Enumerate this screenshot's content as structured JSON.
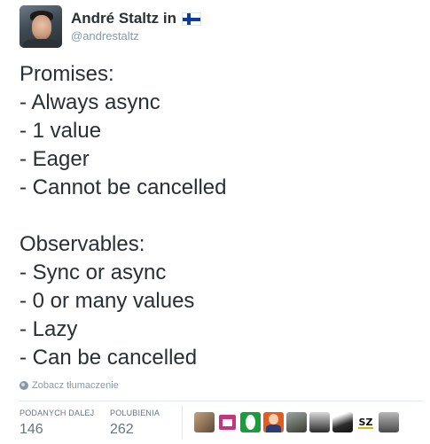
{
  "author": {
    "display_name": "André Staltz in",
    "handle": "@andrestaltz",
    "flag_icon": "finland-flag-icon",
    "avatar_icon": "avatar-photo"
  },
  "tweet": {
    "lines": [
      "Promises:",
      "- Always async",
      "- 1 value",
      "- Eager",
      "- Cannot be cancelled",
      "",
      "Observables:",
      "- Sync or async",
      "- 0 or many values",
      "- Lazy",
      "- Can be cancelled"
    ]
  },
  "translate": {
    "icon": "globe-icon",
    "label": "Zobacz tłumaczenie"
  },
  "stats": {
    "retweets_label": "PODANYCH DALEJ",
    "retweets_value": "146",
    "likes_label": "POLUBIENIA",
    "likes_value": "262"
  },
  "colors": {
    "text": "#292f33",
    "muted": "#8899a6",
    "stat_text": "#66757f",
    "divider": "#e1e8ed",
    "flag_blue": "#0d3b9e"
  },
  "favoriters": {
    "sz_label": "SZ"
  }
}
